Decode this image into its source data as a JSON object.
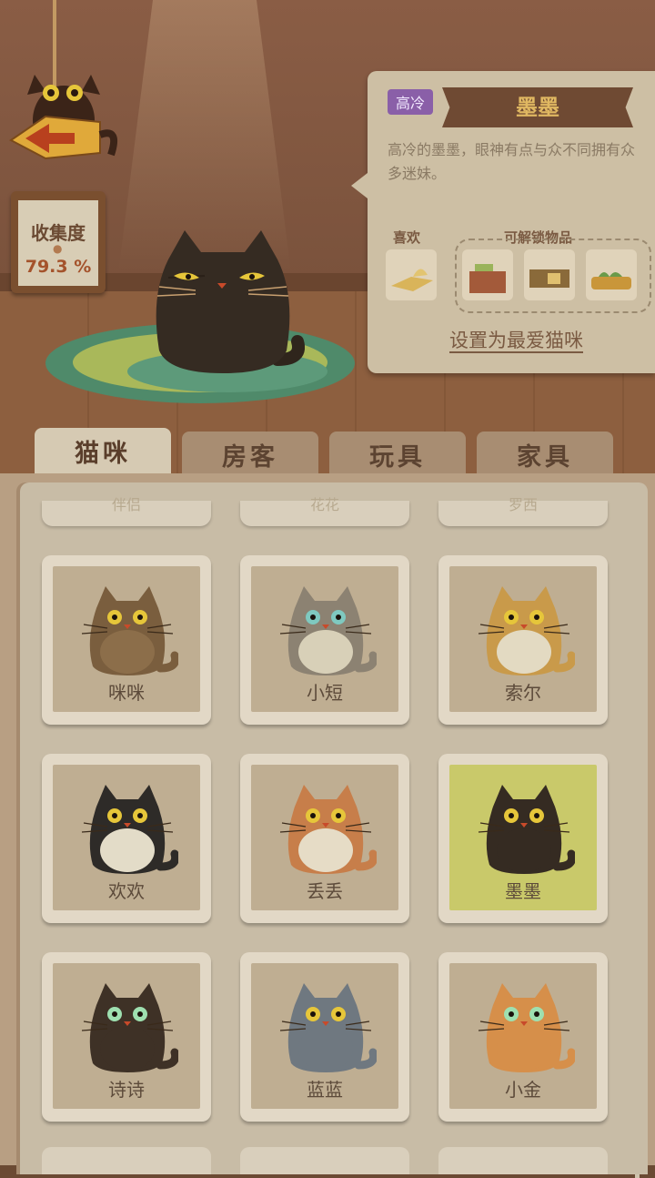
{
  "collection": {
    "title": "收集度",
    "value": "79.3 %"
  },
  "selected_cat": {
    "trait": "高冷",
    "name": "墨墨",
    "description": "高冷的墨墨，眼神有点与众不同拥有众多迷妹。",
    "likes_label": "喜欢",
    "unlock_label": "可解锁物品",
    "favorite_button": "设置为最爱猫咪"
  },
  "tabs": [
    "猫咪",
    "房客",
    "玩具",
    "家具"
  ],
  "partial_cards": [
    "伴侣",
    "花花",
    "罗西"
  ],
  "cats": [
    {
      "name": "咪咪",
      "body": "#7a5e3e",
      "belly": "#8c6e4a",
      "eye": "#e6c63a"
    },
    {
      "name": "小短",
      "body": "#8c8272",
      "belly": "#d8d0b8",
      "eye": "#7fc9c0"
    },
    {
      "name": "索尔",
      "body": "#c99a4a",
      "belly": "#e3dac2",
      "eye": "#e6c63a"
    },
    {
      "name": "欢欢",
      "body": "#2e2b28",
      "belly": "#e3dcc8",
      "eye": "#e6c63a"
    },
    {
      "name": "丢丢",
      "body": "#c77e4a",
      "belly": "#e6dcc6",
      "eye": "#e6c63a"
    },
    {
      "name": "墨墨",
      "body": "#352b22",
      "belly": "#352b22",
      "eye": "#e6c63a"
    },
    {
      "name": "诗诗",
      "body": "#3e3126",
      "belly": "#3e3126",
      "eye": "#9ee0b0"
    },
    {
      "name": "蓝蓝",
      "body": "#6f7880",
      "belly": "#6f7880",
      "eye": "#e6c63a"
    },
    {
      "name": "小金",
      "body": "#d68f4a",
      "belly": "#d68f4a",
      "eye": "#9ee0b0"
    }
  ]
}
